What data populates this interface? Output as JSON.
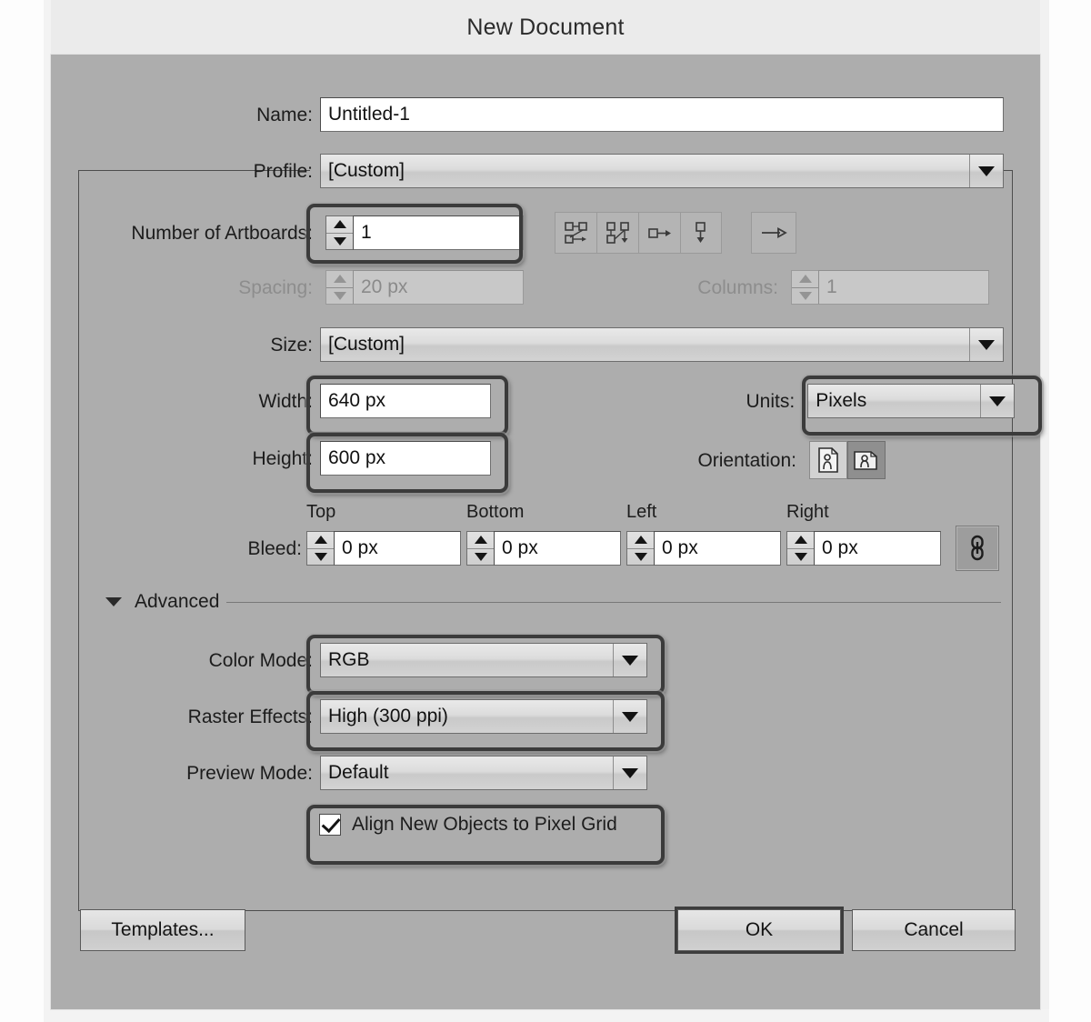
{
  "dialog": {
    "title": "New Document"
  },
  "name_row": {
    "label": "Name:",
    "value": "Untitled-1",
    "placeholder": "Untitled-1"
  },
  "profile_row": {
    "label": "Profile:",
    "value": "[Custom]",
    "icon": "chevron-down-icon"
  },
  "artboards_row": {
    "label": "Number of Artboards:",
    "value": "1",
    "layout_buttons": [
      {
        "name": "grid-by-row-icon",
        "selected": false
      },
      {
        "name": "grid-by-column-icon",
        "selected": false
      },
      {
        "name": "arrange-by-row-icon",
        "selected": false
      },
      {
        "name": "arrange-by-column-icon",
        "selected": false
      }
    ],
    "direction_button": {
      "name": "arrow-right-icon",
      "label": "→"
    }
  },
  "spacing_row": {
    "label": "Spacing:",
    "value": "20 px",
    "disabled": true
  },
  "columns_row": {
    "label": "Columns:",
    "value": "1",
    "disabled": true
  },
  "size_row": {
    "label": "Size:",
    "value": "[Custom]",
    "icon": "chevron-down-icon"
  },
  "width_row": {
    "label": "Width:",
    "value": "640 px"
  },
  "height_row": {
    "label": "Height:",
    "value": "600 px"
  },
  "units_row": {
    "label": "Units:",
    "value": "Pixels",
    "icon": "chevron-down-icon"
  },
  "orientation_row": {
    "label": "Orientation:",
    "options": [
      {
        "name": "orientation-portrait-icon",
        "selected": false
      },
      {
        "name": "orientation-landscape-icon",
        "selected": true
      }
    ]
  },
  "bleed_row": {
    "label": "Bleed:",
    "headers": {
      "top": "Top",
      "bottom": "Bottom",
      "left": "Left",
      "right": "Right"
    },
    "values": {
      "top": "0 px",
      "bottom": "0 px",
      "left": "0 px",
      "right": "0 px"
    },
    "link_button": "link-chain-icon"
  },
  "advanced": {
    "label": "Advanced",
    "expanded": true,
    "color_mode": {
      "label": "Color Mode:",
      "value": "RGB"
    },
    "raster_effects": {
      "label": "Raster Effects:",
      "value": "High (300 ppi)"
    },
    "preview_mode": {
      "label": "Preview Mode:",
      "value": "Default"
    },
    "align_pixel_grid": {
      "label": "Align New Objects to Pixel Grid",
      "checked": true
    }
  },
  "footer": {
    "templates": "Templates...",
    "ok": "OK",
    "cancel": "Cancel"
  },
  "colors": {
    "dialog_background": "#adadad",
    "titlebar_background": "#ebebeb",
    "highlight_ring": "#3b3b3b",
    "input_background": "#ffffff",
    "disabled_text": "#8d8d8d"
  }
}
